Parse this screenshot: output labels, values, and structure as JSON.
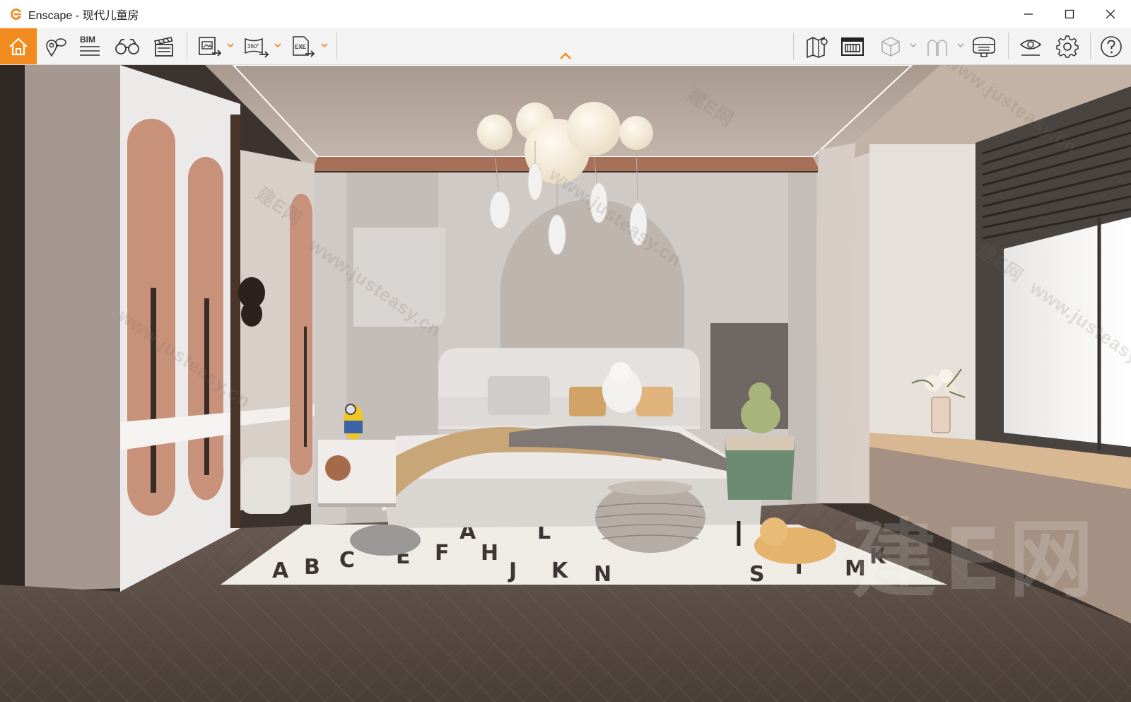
{
  "window": {
    "app_name": "Enscape",
    "title": "Enscape - 现代儿童房",
    "controls": {
      "minimize": "minimize-icon",
      "maximize": "maximize-icon",
      "close": "close-icon"
    }
  },
  "toolbar": {
    "home": "home-icon",
    "bim_label": "BIM",
    "screenshot_360_label": "360°",
    "exe_label": "EXE",
    "accent_color": "#f28b1f"
  },
  "viewport": {
    "watermarks": [
      "www.justeasy.cn",
      "建E网"
    ],
    "brand_watermark": "建E网"
  }
}
